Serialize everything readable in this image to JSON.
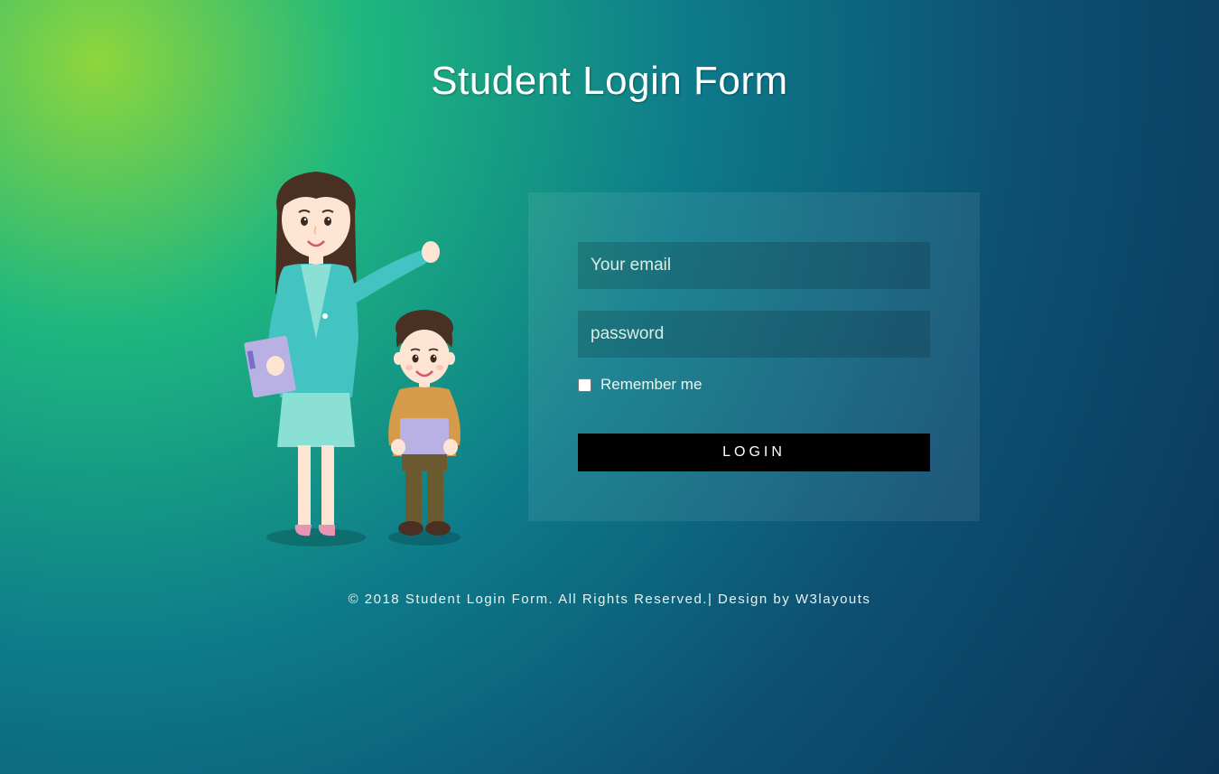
{
  "title": "Student Login Form",
  "form": {
    "email_placeholder": "Your email",
    "password_placeholder": "password",
    "remember_label": "Remember me",
    "login_button": "LOGIN"
  },
  "footer": {
    "text_prefix": "© 2018 Student Login Form. All Rights Reserved.| Design by ",
    "link_text": "W3layouts"
  }
}
